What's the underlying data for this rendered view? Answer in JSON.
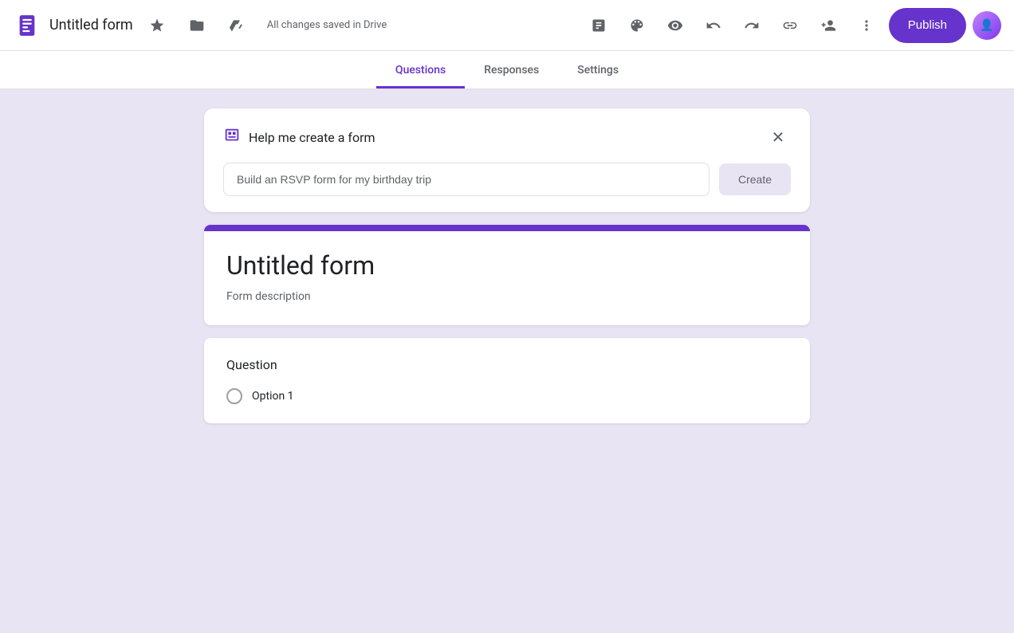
{
  "topbar": {
    "app_icon_label": "Google Forms",
    "form_title": "Untitled form",
    "save_status": "All changes saved in Drive",
    "publish_label": "Publish",
    "icons": {
      "add_question": "add-question-icon",
      "palette": "palette-icon",
      "preview": "preview-icon",
      "undo": "undo-icon",
      "redo": "redo-icon",
      "link": "link-icon",
      "add_collaborator": "add-collaborator-icon",
      "more": "more-icon"
    }
  },
  "tabs": {
    "items": [
      {
        "label": "Questions",
        "active": true
      },
      {
        "label": "Responses",
        "active": false
      },
      {
        "label": "Settings",
        "active": false
      }
    ]
  },
  "ai_card": {
    "title": "Help me create a form",
    "input_placeholder": "Build an RSVP form for my birthday trip",
    "input_value": "Build an RSVP form for my birthday trip",
    "create_label": "Create"
  },
  "form": {
    "title": "Untitled form",
    "description": "Form description",
    "question_label": "Question",
    "option1_label": "Option 1"
  },
  "colors": {
    "brand_purple": "#6633cc",
    "background": "#e8e4f3",
    "text_primary": "#202124",
    "text_secondary": "#5f6368"
  }
}
